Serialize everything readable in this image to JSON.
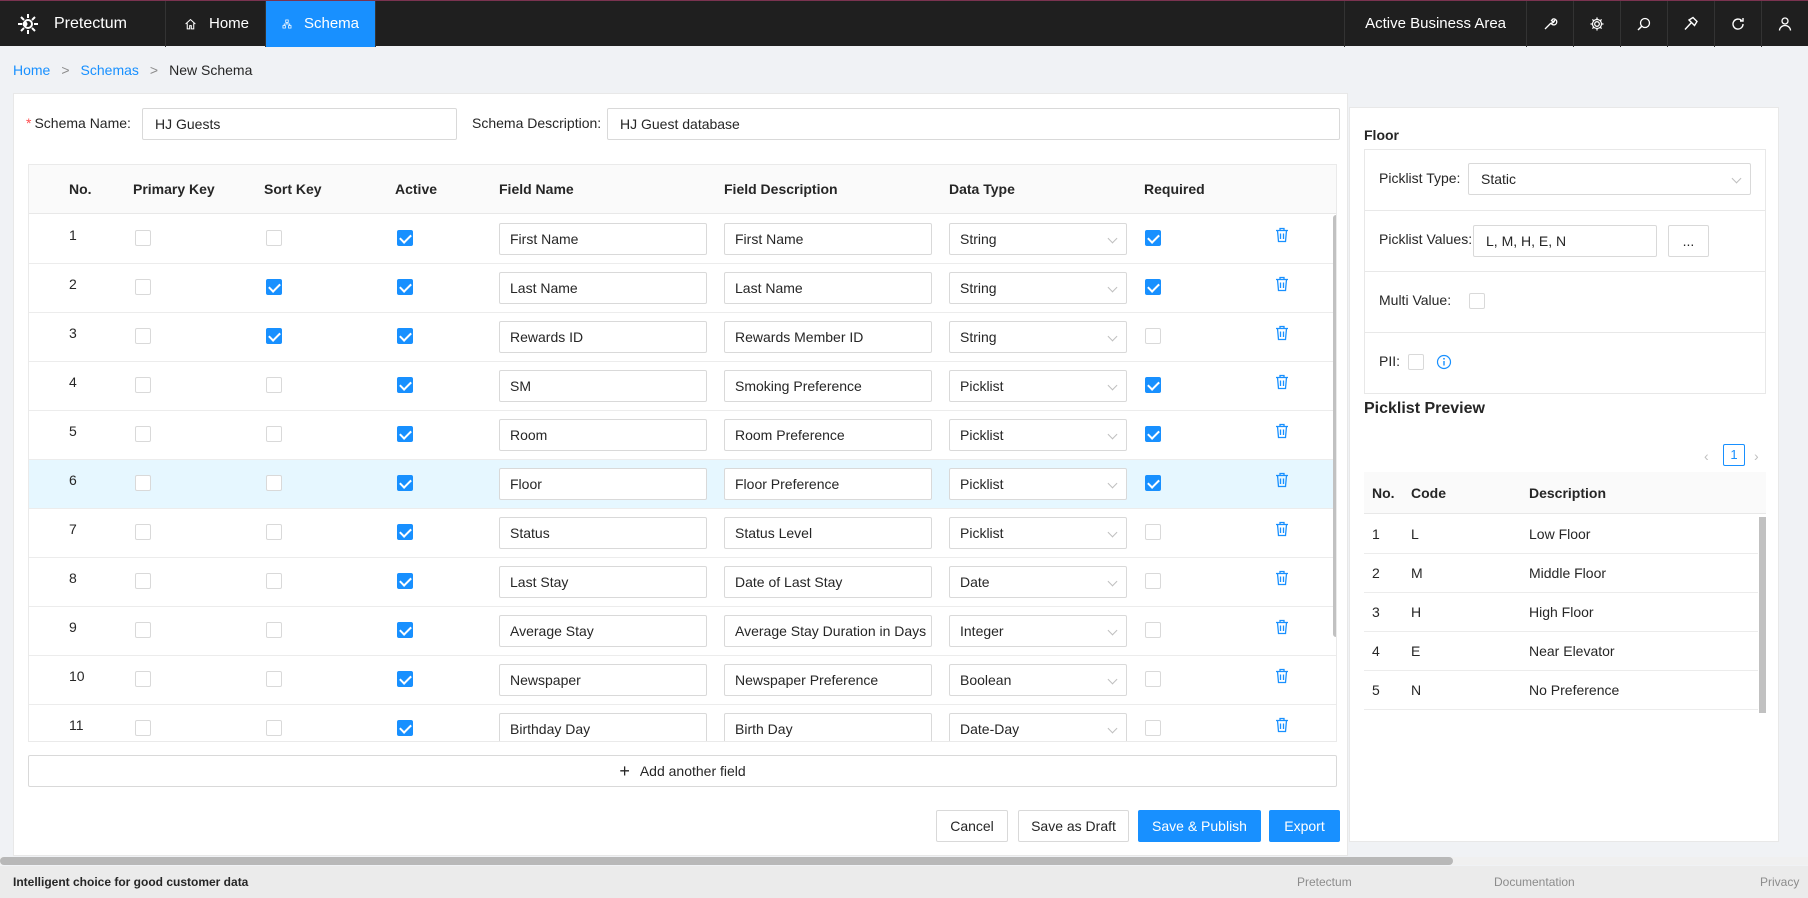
{
  "app": {
    "name": "Pretectum"
  },
  "nav": {
    "home": "Home",
    "schema": "Schema",
    "business_area": "Active Business Area"
  },
  "breadcrumb": {
    "home": "Home",
    "schemas": "Schemas",
    "current": "New Schema",
    "sep": ">"
  },
  "form": {
    "schema_name_label": "Schema Name",
    "schema_name_value": "HJ Guests",
    "schema_desc_label": "Schema Description",
    "schema_desc_value": "HJ Guest database",
    "colon": ":"
  },
  "table": {
    "headers": {
      "no": "No.",
      "primary_key": "Primary Key",
      "sort_key": "Sort Key",
      "active": "Active",
      "field_name": "Field Name",
      "field_description": "Field Description",
      "data_type": "Data Type",
      "required": "Required"
    },
    "rows": [
      {
        "no": "1",
        "pk": false,
        "sk": false,
        "active": true,
        "name": "First Name",
        "desc": "First Name",
        "type": "String",
        "required": true,
        "selected": false
      },
      {
        "no": "2",
        "pk": false,
        "sk": true,
        "active": true,
        "name": "Last Name",
        "desc": "Last Name",
        "type": "String",
        "required": true,
        "selected": false
      },
      {
        "no": "3",
        "pk": false,
        "sk": true,
        "active": true,
        "name": "Rewards ID",
        "desc": "Rewards Member ID",
        "type": "String",
        "required": false,
        "selected": false
      },
      {
        "no": "4",
        "pk": false,
        "sk": false,
        "active": true,
        "name": "SM",
        "desc": "Smoking Preference",
        "type": "Picklist",
        "required": true,
        "selected": false
      },
      {
        "no": "5",
        "pk": false,
        "sk": false,
        "active": true,
        "name": "Room",
        "desc": "Room Preference",
        "type": "Picklist",
        "required": true,
        "selected": false
      },
      {
        "no": "6",
        "pk": false,
        "sk": false,
        "active": true,
        "name": "Floor",
        "desc": "Floor Preference",
        "type": "Picklist",
        "required": true,
        "selected": true
      },
      {
        "no": "7",
        "pk": false,
        "sk": false,
        "active": true,
        "name": "Status",
        "desc": "Status Level",
        "type": "Picklist",
        "required": false,
        "selected": false
      },
      {
        "no": "8",
        "pk": false,
        "sk": false,
        "active": true,
        "name": "Last Stay",
        "desc": "Date of Last Stay",
        "type": "Date",
        "required": false,
        "selected": false
      },
      {
        "no": "9",
        "pk": false,
        "sk": false,
        "active": true,
        "name": "Average Stay",
        "desc": "Average Stay Duration in Days",
        "type": "Integer",
        "required": false,
        "selected": false
      },
      {
        "no": "10",
        "pk": false,
        "sk": false,
        "active": true,
        "name": "Newspaper",
        "desc": "Newspaper Preference",
        "type": "Boolean",
        "required": false,
        "selected": false
      },
      {
        "no": "11",
        "pk": false,
        "sk": false,
        "active": true,
        "name": "Birthday Day",
        "desc": "Birth Day",
        "type": "Date-Day",
        "required": false,
        "selected": false
      }
    ]
  },
  "actions": {
    "add_field": "Add another field",
    "cancel": "Cancel",
    "save_draft": "Save as Draft",
    "save_publish": "Save & Publish",
    "export": "Export"
  },
  "side": {
    "title": "Floor",
    "picklist_type_label": "Picklist Type",
    "picklist_type_value": "Static",
    "picklist_values_label": "Picklist Values",
    "picklist_values_value": "L, M, H, E, N",
    "more_button": "...",
    "multi_value_label": "Multi Value",
    "pii_label": "PII",
    "colon": ":",
    "preview_title": "Picklist Preview",
    "page": "1",
    "preview_headers": {
      "no": "No.",
      "code": "Code",
      "description": "Description"
    },
    "preview_rows": [
      {
        "no": "1",
        "code": "L",
        "description": "Low Floor"
      },
      {
        "no": "2",
        "code": "M",
        "description": "Middle Floor"
      },
      {
        "no": "3",
        "code": "H",
        "description": "High Floor"
      },
      {
        "no": "4",
        "code": "E",
        "description": "Near Elevator"
      },
      {
        "no": "5",
        "code": "N",
        "description": "No Preference"
      }
    ]
  },
  "footer": {
    "tagline": "Intelligent choice for good customer data",
    "links": [
      "Pretectum",
      "Documentation",
      "Privacy"
    ]
  },
  "colors": {
    "accent": "#1890ff",
    "topbar": "#1f1f1f",
    "danger": "#ff4d4f"
  },
  "icons": [
    "logo-icon",
    "home-icon",
    "schema-icon",
    "tools-icon",
    "gear-icon",
    "search-icon",
    "hammer-icon",
    "refresh-icon",
    "user-icon",
    "trash-icon",
    "info-icon",
    "plus-icon",
    "chevron-down-icon"
  ]
}
